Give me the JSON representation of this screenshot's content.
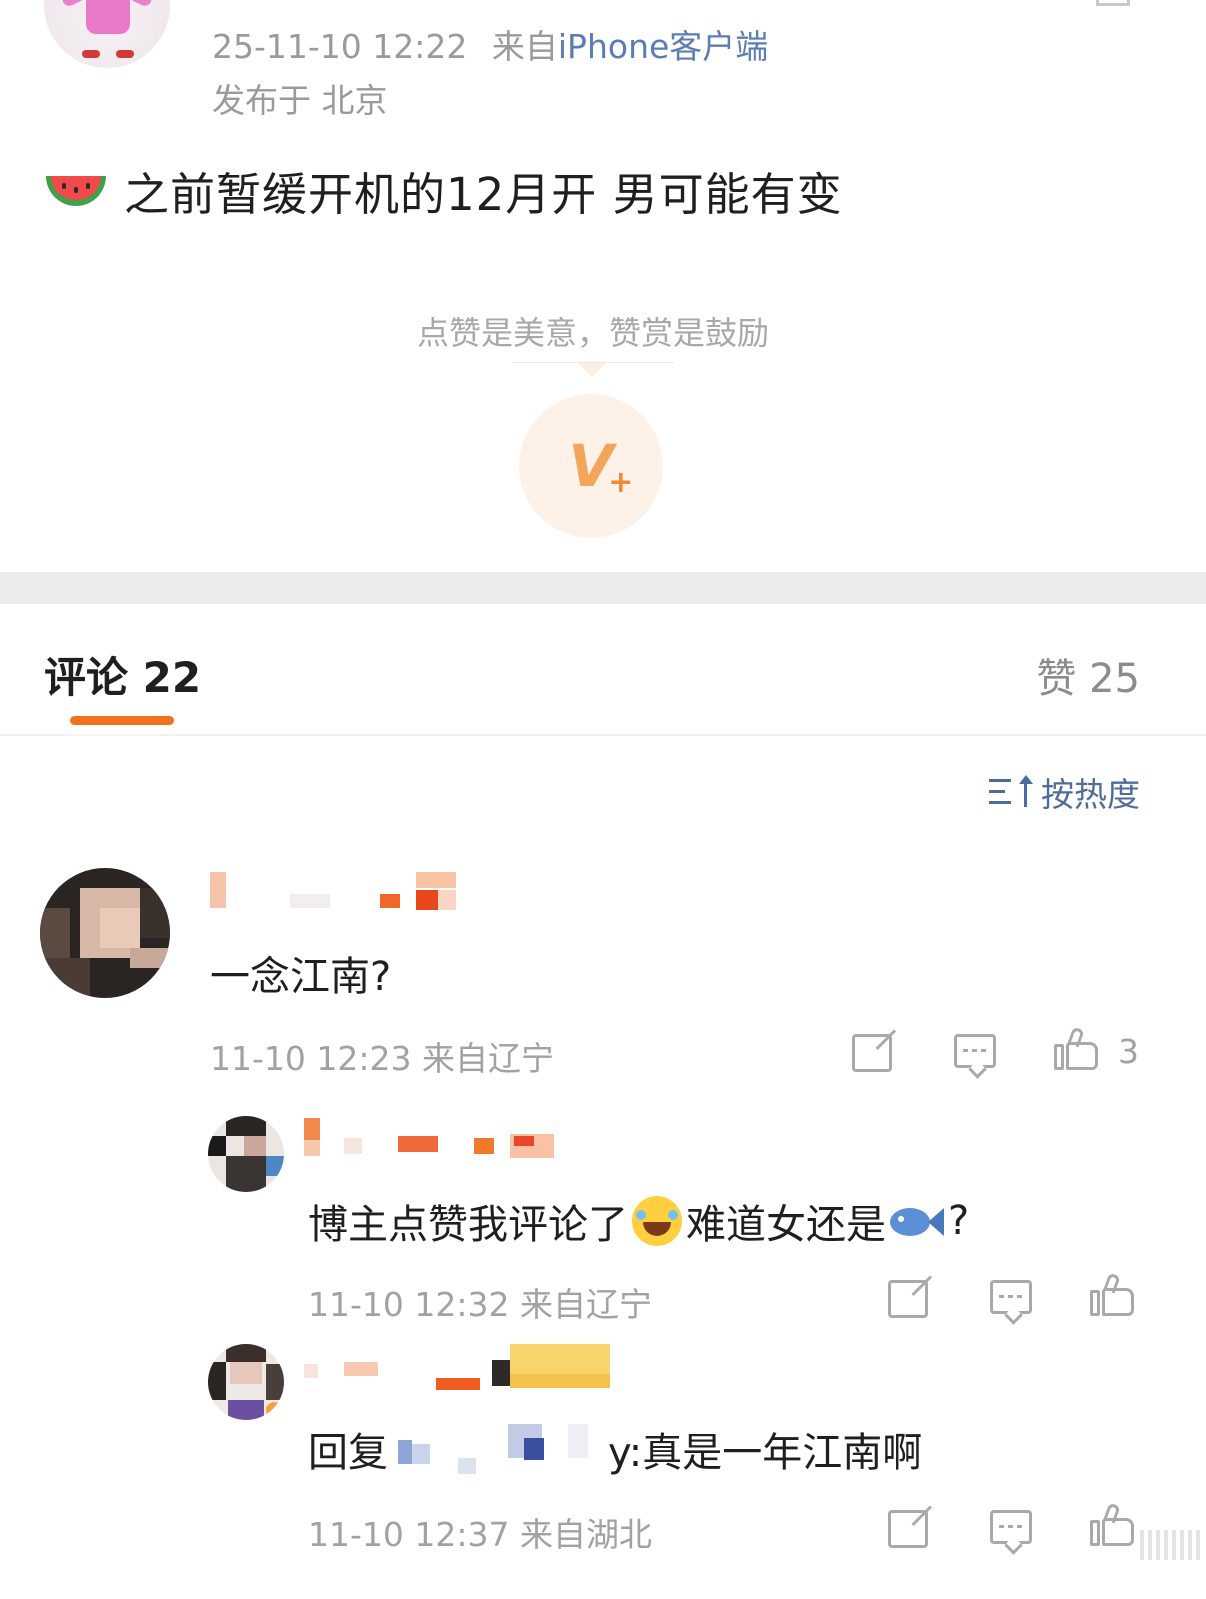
{
  "post": {
    "timestamp": "25-11-10 12:22",
    "source_prefix": "来自",
    "source_client": "iPhone客户端",
    "location": "发布于 北京",
    "emoji": "watermelon",
    "text": "之前暂缓开机的12月开 男可能有变"
  },
  "reward": {
    "prompt": "点赞是美意，赞赏是鼓励",
    "button_glyph": "V",
    "button_plus": "+"
  },
  "tabs": {
    "comments_label": "评论 22",
    "likes_label": "赞 25"
  },
  "sort": {
    "label": "按热度",
    "icon": "sort-hot-icon"
  },
  "comments": [
    {
      "text": "一念江南?",
      "meta": "11-10 12:23 来自辽宁",
      "like_count": "3",
      "username_redacted": true
    },
    {
      "text_before": "博主点赞我评论了",
      "emoji_1": "laughing-tears",
      "text_middle": "难道女还是",
      "emoji_2": "fish",
      "text_after": "?",
      "meta": "11-10 12:32 来自辽宁",
      "like_count": "",
      "username_redacted": true
    },
    {
      "reply_prefix": "回复",
      "reply_suffix": "y:真是一年江南啊",
      "meta": "11-10 12:37 来自湖北",
      "like_count": "",
      "username_redacted": true
    }
  ],
  "colors": {
    "accent_orange": "#f2721c",
    "link_blue": "#5b7db5",
    "sort_blue": "#4f6d9c",
    "meta_gray": "#a2a2a2"
  }
}
